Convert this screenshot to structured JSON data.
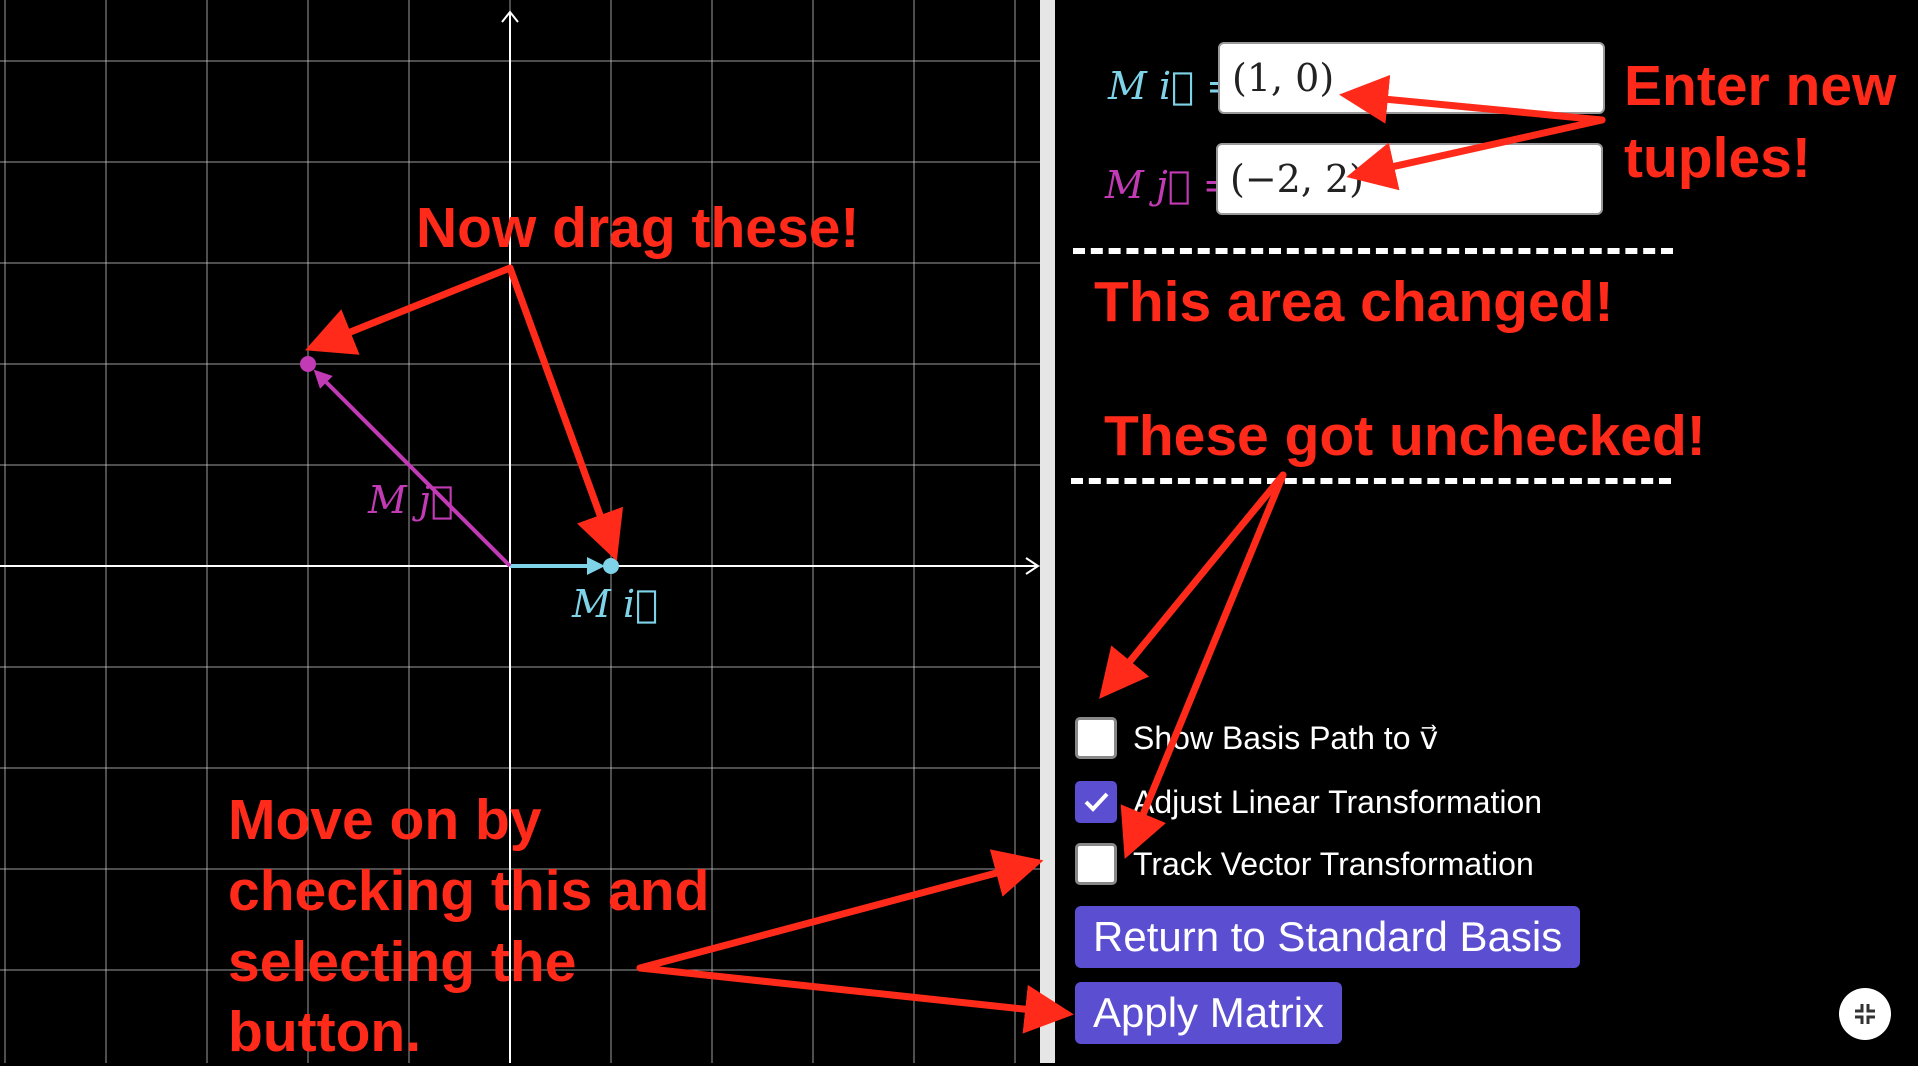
{
  "graph": {
    "vector_i_label": "M i⃗",
    "vector_j_label": "M j⃗",
    "colors": {
      "i": "#7fd3e8",
      "j": "#c23bb5",
      "grid": "#cfcfcf"
    }
  },
  "panel": {
    "mi_label": "M i⃗ =",
    "mj_label": "M j⃗ =",
    "mi_value": "(1, 0)",
    "mj_value": "(−2, 2)",
    "checkboxes": [
      {
        "label": "Show Basis Path to v⃗",
        "checked": false
      },
      {
        "label": "Adjust Linear Transformation",
        "checked": true
      },
      {
        "label": "Track Vector Transformation",
        "checked": false
      }
    ],
    "buttons": {
      "return_label": "Return to Standard Basis",
      "apply_label": "Apply Matrix"
    },
    "accent_color": "#5b4ed1"
  },
  "annotations": {
    "drag": "Now drag these!",
    "enter_new": "Enter new",
    "tuples": "tuples!",
    "area_changed": "This area changed!",
    "unchecked": "These got unchecked!",
    "move_on_1": "Move on by",
    "move_on_2": "checking this and",
    "move_on_3": "selecting the",
    "move_on_4": "button."
  }
}
